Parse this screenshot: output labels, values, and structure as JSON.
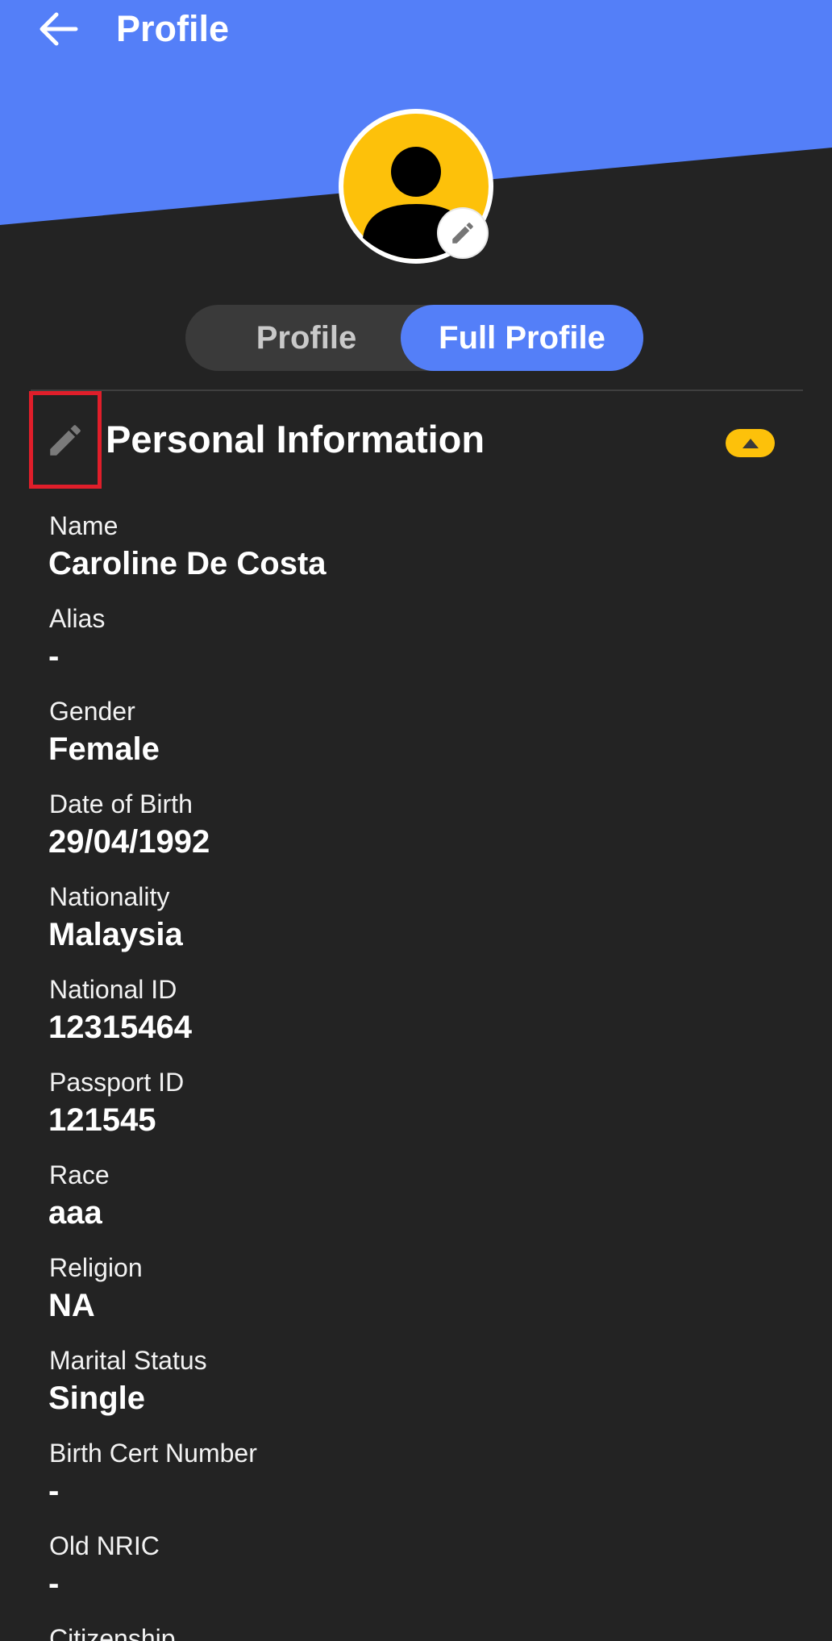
{
  "colors": {
    "header_blue": "#547ff8",
    "background": "#232323",
    "accent_yellow": "#fdc10a",
    "highlight_red": "#e01e2a"
  },
  "app_bar": {
    "title": "Profile",
    "back_icon": "arrow-left-icon"
  },
  "avatar": {
    "icon": "person-icon",
    "edit_icon": "pencil-icon"
  },
  "tabs": [
    {
      "label": "Profile",
      "selected": false
    },
    {
      "label": "Full Profile",
      "selected": true
    }
  ],
  "section": {
    "title": "Personal Information",
    "edit_icon": "pencil-icon",
    "collapse_icon": "caret-up-icon"
  },
  "fields": [
    {
      "label": "Name",
      "value": "Caroline De Costa"
    },
    {
      "label": "Alias",
      "value": "-"
    },
    {
      "label": "Gender",
      "value": "Female"
    },
    {
      "label": "Date of Birth",
      "value": "29/04/1992"
    },
    {
      "label": "Nationality",
      "value": "Malaysia"
    },
    {
      "label": "National ID",
      "value": "12315464"
    },
    {
      "label": "Passport ID",
      "value": "121545"
    },
    {
      "label": "Race",
      "value": "aaa"
    },
    {
      "label": "Religion",
      "value": "NA"
    },
    {
      "label": "Marital Status",
      "value": "Single"
    },
    {
      "label": "Birth Cert Number",
      "value": "-"
    },
    {
      "label": "Old NRIC",
      "value": "-"
    },
    {
      "label": "Citizenship",
      "value": ""
    }
  ]
}
